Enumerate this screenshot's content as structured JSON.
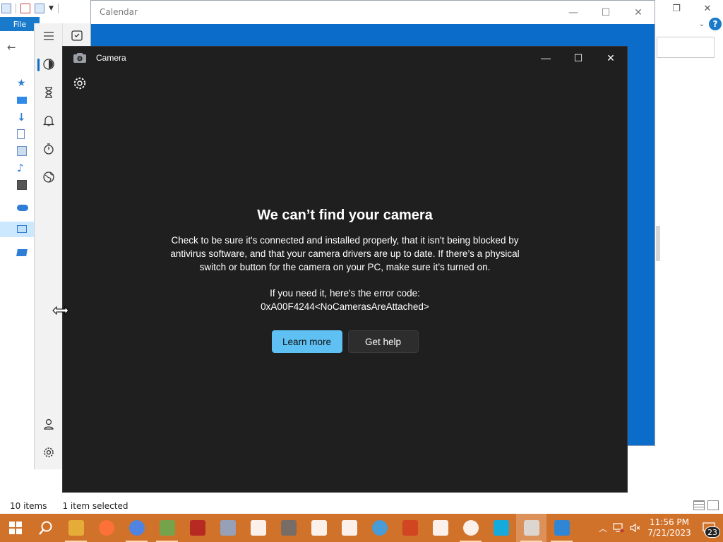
{
  "explorer": {
    "ribbon": {
      "file_tab": "File"
    },
    "status": {
      "item_count": "10 items",
      "selection": "1 item selected"
    }
  },
  "calendar": {
    "title": "Calendar"
  },
  "camera": {
    "title": "Camera",
    "error": {
      "heading": "We can’t find your camera",
      "body": "Check to be sure it's connected and installed properly, that it isn't being blocked by antivirus software, and that your camera drivers are up to date. If there’s a physical switch or button for the camera on your PC, make sure it’s turned on.",
      "code_intro": "If you need it, here's the error code:",
      "code": "0xA00F4244<NoCamerasAreAttached>"
    },
    "buttons": {
      "learn_more": "Learn more",
      "get_help": "Get help"
    }
  },
  "taskbar": {
    "items": [
      {
        "icon": "file-explorer-icon",
        "color": "#e8b23a"
      },
      {
        "icon": "firefox-icon",
        "color": "#ff7139"
      },
      {
        "icon": "chrome-icon",
        "color": "#4285f4"
      },
      {
        "icon": "photo-app-icon",
        "color": "#6aa84f"
      },
      {
        "icon": "security-app-icon",
        "color": "#b22222"
      },
      {
        "icon": "scanner-app-icon",
        "color": "#8fa6c9"
      },
      {
        "icon": "shield-icon",
        "color": "#ffffff"
      },
      {
        "icon": "calculator-icon",
        "color": "#6d6d6d"
      },
      {
        "icon": "3d-viewer-icon",
        "color": "#ffffff"
      },
      {
        "icon": "solitaire-icon",
        "color": "#ffffff"
      },
      {
        "icon": "tips-icon",
        "color": "#3aa0e8"
      },
      {
        "icon": "media-app-icon",
        "color": "#d04020"
      },
      {
        "icon": "settings-icon",
        "color": "#ffffff"
      },
      {
        "icon": "clock-app-icon",
        "color": "#ffffff"
      },
      {
        "icon": "skype-icon",
        "color": "#00aff0"
      },
      {
        "icon": "camera-icon",
        "color": "#dddddd"
      },
      {
        "icon": "calendar-icon",
        "color": "#1e88e5"
      }
    ],
    "tray": {
      "time": "11:56 PM",
      "date": "7/21/2023",
      "notification_count": "23"
    }
  },
  "colors": {
    "taskbar": "#d1722b",
    "camera_bg": "#1f1f1f",
    "accent_button": "#5ec0f3",
    "calendar_blue": "#0b6cc9"
  }
}
